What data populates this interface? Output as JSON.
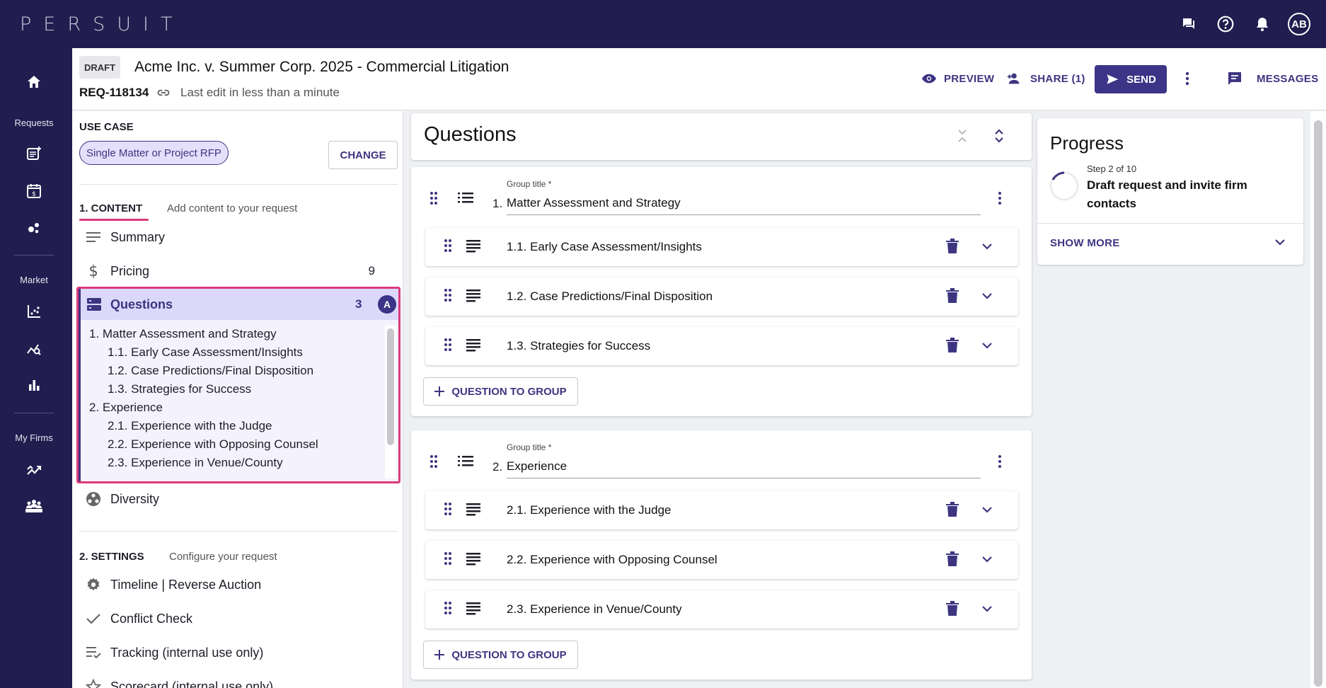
{
  "brand": {
    "logo_text": "PERSUIT"
  },
  "topbar": {
    "avatar_initials": "AB"
  },
  "rail": {
    "requests_label": "Requests",
    "market_label": "Market",
    "my_firms_label": "My Firms"
  },
  "header": {
    "status_chip": "DRAFT",
    "title": "Acme Inc. v. Summer Corp. 2025 - Commercial Litigation",
    "request_id": "REQ-118134",
    "last_edit": "Last edit in less than a minute",
    "preview_label": "PREVIEW",
    "share_label": "SHARE (1)",
    "send_label": "SEND",
    "messages_label": "MESSAGES"
  },
  "left_panel": {
    "use_case_heading": "USE CASE",
    "use_case_value": "Single Matter or Project RFP",
    "change_label": "CHANGE",
    "content_section": {
      "title": "1. CONTENT",
      "hint": "Add content to your request"
    },
    "content_items": [
      {
        "label": "Summary"
      },
      {
        "label": "Pricing",
        "count": "9"
      },
      {
        "label": "Questions",
        "count": "3",
        "badge": "A"
      },
      {
        "label": "Diversity"
      }
    ],
    "questions_toc": [
      "1. Matter Assessment and Strategy",
      "1.1. Early Case Assessment/Insights",
      "1.2. Case Predictions/Final Disposition",
      "1.3. Strategies for Success",
      "2. Experience",
      "2.1. Experience with the Judge",
      "2.2. Experience with Opposing Counsel",
      "2.3. Experience in Venue/County"
    ],
    "settings_section": {
      "title": "2. SETTINGS",
      "hint": "Configure your request"
    },
    "settings_items": [
      {
        "label": "Timeline | Reverse Auction"
      },
      {
        "label": "Conflict Check"
      },
      {
        "label": "Tracking (internal use only)"
      },
      {
        "label": "Scorecard (internal use only)"
      }
    ]
  },
  "questions_panel": {
    "title": "Questions",
    "groups": [
      {
        "number": "1.",
        "label": "Group title *",
        "title": "Matter Assessment and Strategy",
        "questions": [
          "1.1. Early Case Assessment/Insights",
          "1.2. Case Predictions/Final Disposition",
          "1.3. Strategies for Success"
        ],
        "add_label": "QUESTION TO GROUP"
      },
      {
        "number": "2.",
        "label": "Group title *",
        "title": "Experience",
        "questions": [
          "2.1. Experience with the Judge",
          "2.2. Experience with Opposing Counsel",
          "2.3. Experience in Venue/County"
        ],
        "add_label": "QUESTION TO GROUP"
      }
    ]
  },
  "progress": {
    "title": "Progress",
    "step": "Step 2 of 10",
    "description": "Draft request and invite firm contacts",
    "show_more": "SHOW MORE"
  },
  "colors": {
    "nav_bg": "#221d4f",
    "accent": "#3b3487",
    "highlight_border": "#dc3a7c",
    "selected_bg": "#dcd8fa"
  }
}
